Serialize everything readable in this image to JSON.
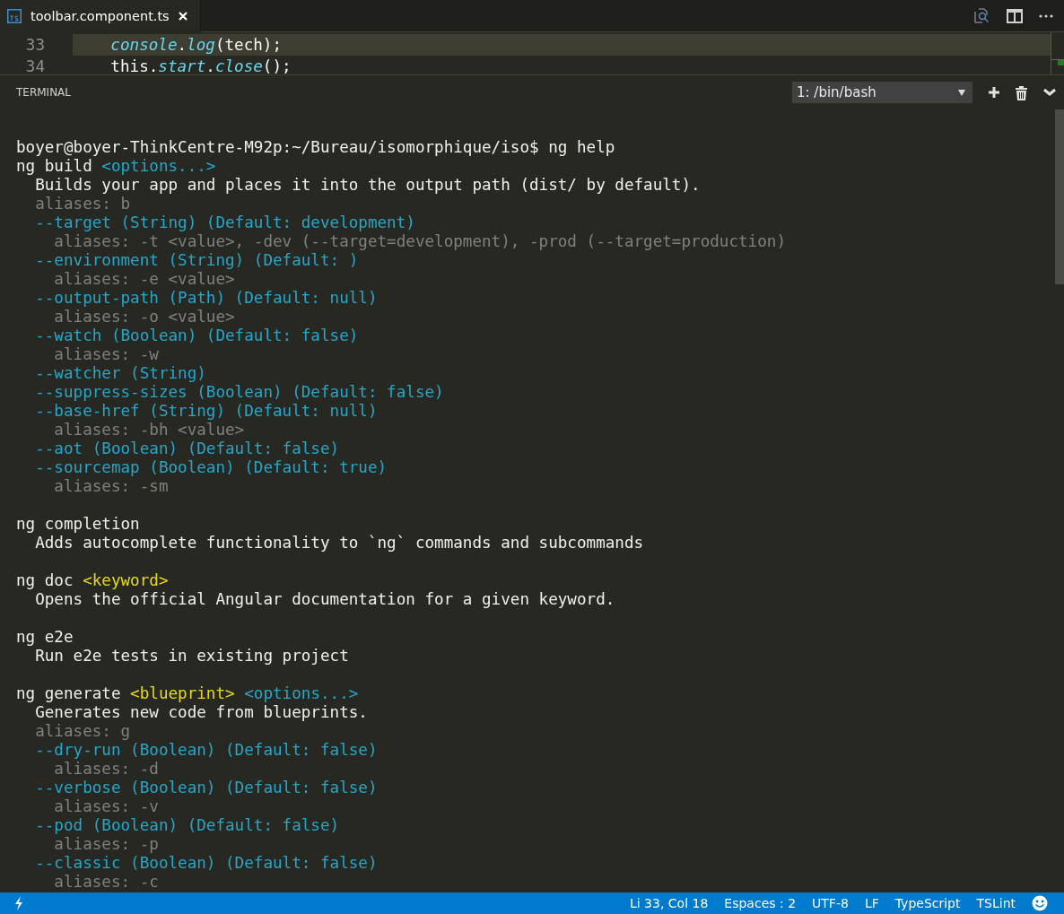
{
  "tabs": [
    {
      "label": "toolbar.component.ts",
      "selected": true
    }
  ],
  "editor": {
    "lines": [
      {
        "number": "33",
        "current": true,
        "code": "*console*.*log*(tech);"
      },
      {
        "number": "34",
        "current": false,
        "code": "this.*start*.*close*();"
      }
    ]
  },
  "panel": {
    "title": "TERMINAL",
    "terminal_select": "1: /bin/bash"
  },
  "terminal": {
    "blocks": [
      [
        [
          {
            "text": "boyer@boyer-ThinkCentre-M92p:~/Bureau/isomorphique/iso$ ng help",
            "kind": "plain"
          }
        ],
        [
          {
            "text": "ng build ",
            "kind": "plain"
          },
          {
            "text": "<options...>",
            "kind": "option"
          }
        ],
        [
          {
            "text": "  Builds your app and places it into the output path (dist/ by default).",
            "kind": "plain"
          }
        ],
        [
          {
            "text": "  aliases: b",
            "kind": "alias"
          }
        ],
        [
          {
            "text": "  --target (String) (Default: development)",
            "kind": "option"
          }
        ],
        [
          {
            "text": "    aliases: -t <value>, -dev (--target=development), -prod (--target=production)",
            "kind": "alias"
          }
        ],
        [
          {
            "text": "  --environment (String) (Default: )",
            "kind": "option"
          }
        ],
        [
          {
            "text": "    aliases: -e <value>",
            "kind": "alias"
          }
        ],
        [
          {
            "text": "  --output-path (Path) (Default: null)",
            "kind": "option"
          }
        ],
        [
          {
            "text": "    aliases: -o <value>",
            "kind": "alias"
          }
        ],
        [
          {
            "text": "  --watch (Boolean) (Default: false)",
            "kind": "option"
          }
        ],
        [
          {
            "text": "    aliases: -w",
            "kind": "alias"
          }
        ],
        [
          {
            "text": "  --watcher (String)",
            "kind": "option"
          }
        ],
        [
          {
            "text": "  --suppress-sizes (Boolean) (Default: false)",
            "kind": "option"
          }
        ],
        [
          {
            "text": "  --base-href (String) (Default: null)",
            "kind": "option"
          }
        ],
        [
          {
            "text": "    aliases: -bh <value>",
            "kind": "alias"
          }
        ],
        [
          {
            "text": "  --aot (Boolean) (Default: false)",
            "kind": "option"
          }
        ],
        [
          {
            "text": "  --sourcemap (Boolean) (Default: true)",
            "kind": "option"
          }
        ],
        [
          {
            "text": "    aliases: -sm",
            "kind": "alias"
          }
        ]
      ],
      [
        [
          {
            "text": "ng completion",
            "kind": "plain"
          }
        ],
        [
          {
            "text": "  Adds autocomplete functionality to `ng` commands and subcommands",
            "kind": "plain"
          }
        ]
      ],
      [
        [
          {
            "text": "ng doc ",
            "kind": "plain"
          },
          {
            "text": "<keyword>",
            "kind": "keyword"
          }
        ],
        [
          {
            "text": "  Opens the official Angular documentation for a given keyword.",
            "kind": "plain"
          }
        ]
      ],
      [
        [
          {
            "text": "ng e2e",
            "kind": "plain"
          }
        ],
        [
          {
            "text": "  Run e2e tests in existing project",
            "kind": "plain"
          }
        ]
      ],
      [
        [
          {
            "text": "ng generate ",
            "kind": "plain"
          },
          {
            "text": "<blueprint>",
            "kind": "keyword"
          },
          {
            "text": " <options...>",
            "kind": "option"
          }
        ],
        [
          {
            "text": "  Generates new code from blueprints.",
            "kind": "plain"
          }
        ],
        [
          {
            "text": "  aliases: g",
            "kind": "alias"
          }
        ],
        [
          {
            "text": "  --dry-run (Boolean) (Default: false)",
            "kind": "option"
          }
        ],
        [
          {
            "text": "    aliases: -d",
            "kind": "alias"
          }
        ],
        [
          {
            "text": "  --verbose (Boolean) (Default: false)",
            "kind": "option"
          }
        ],
        [
          {
            "text": "    aliases: -v",
            "kind": "alias"
          }
        ],
        [
          {
            "text": "  --pod (Boolean) (Default: false)",
            "kind": "option"
          }
        ],
        [
          {
            "text": "    aliases: -p",
            "kind": "alias"
          }
        ],
        [
          {
            "text": "  --classic (Boolean) (Default: false)",
            "kind": "option"
          }
        ],
        [
          {
            "text": "    aliases: -c",
            "kind": "alias"
          }
        ]
      ]
    ]
  },
  "status_bar": {
    "items": [
      "Li 33, Col 18",
      "Espaces : 2",
      "UTF-8",
      "LF",
      "TypeScript",
      "TSLint"
    ]
  }
}
